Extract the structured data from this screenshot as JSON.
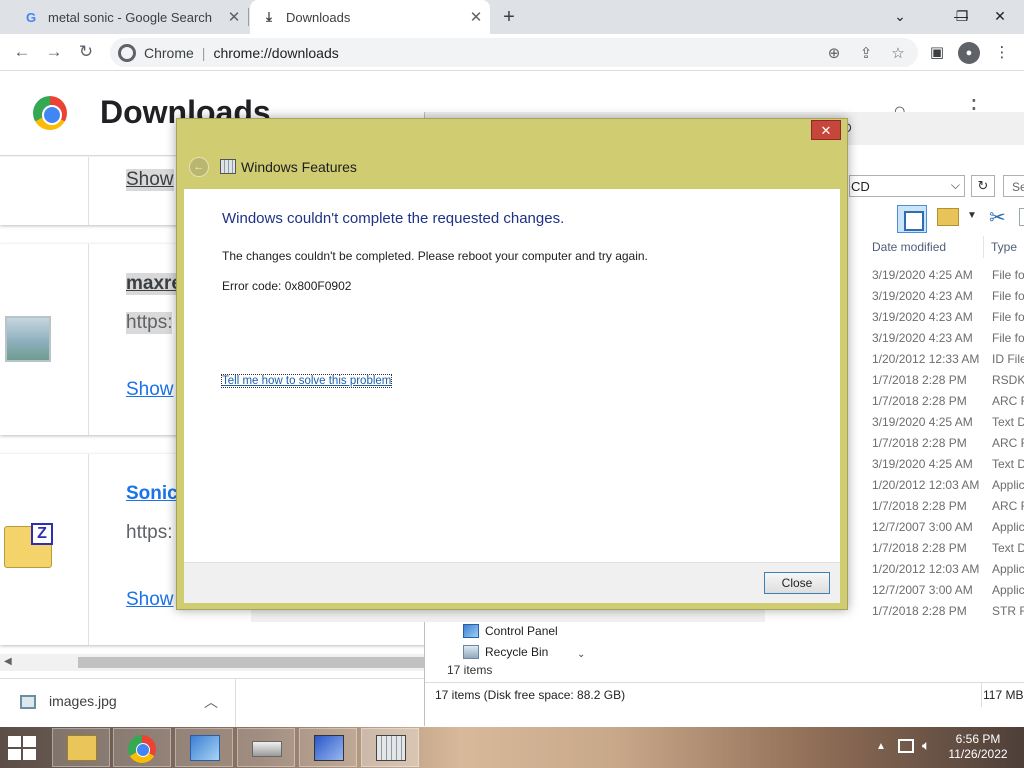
{
  "browser": {
    "tabs": [
      {
        "title": "metal sonic - Google Search",
        "icon": "google-icon"
      },
      {
        "title": "Downloads",
        "icon": "download-icon"
      }
    ],
    "omnibox": {
      "site_label": "Chrome",
      "separator": "|",
      "url": "chrome://downloads"
    }
  },
  "downloads_page": {
    "title": "Downloads",
    "items": [
      {
        "name_partial": "",
        "url_partial": "",
        "show_link": "Show"
      },
      {
        "name_partial": "maxre",
        "url_partial": "https:",
        "show_link": "Show"
      },
      {
        "name_partial": "Sonic",
        "url_partial": "https:",
        "show_link": "Show"
      }
    ],
    "download_bar": {
      "file_name": "images.jpg"
    }
  },
  "explorer": {
    "title_fragment": "D",
    "address": "CD",
    "search_placeholder": "Se",
    "columns": {
      "date": "Date modified",
      "type": "Type"
    },
    "rows": [
      {
        "date": "3/19/2020 4:25 AM",
        "type": "File fo"
      },
      {
        "date": "3/19/2020 4:23 AM",
        "type": "File fo"
      },
      {
        "date": "3/19/2020 4:23 AM",
        "type": "File fo"
      },
      {
        "date": "3/19/2020 4:23 AM",
        "type": "File fo"
      },
      {
        "date": "1/20/2012 12:33 AM",
        "type": "ID File"
      },
      {
        "date": "1/7/2018 2:28 PM",
        "type": "RSDK I"
      },
      {
        "date": "1/7/2018 2:28 PM",
        "type": "ARC F"
      },
      {
        "date": "3/19/2020 4:25 AM",
        "type": "Text D"
      },
      {
        "date": "1/7/2018 2:28 PM",
        "type": "ARC F"
      },
      {
        "date": "3/19/2020 4:25 AM",
        "type": "Text D"
      },
      {
        "date": "1/20/2012 12:03 AM",
        "type": "Applic"
      },
      {
        "date": "1/7/2018 2:28 PM",
        "type": "ARC F"
      },
      {
        "date": "12/7/2007 3:00 AM",
        "type": "Applic"
      },
      {
        "date": "1/7/2018 2:28 PM",
        "type": "Text D"
      },
      {
        "date": "1/20/2012 12:03 AM",
        "type": "Applic"
      },
      {
        "date": "12/7/2007 3:00 AM",
        "type": "Applic"
      },
      {
        "date": "1/7/2018 2:28 PM",
        "type": "STR Fi"
      }
    ],
    "nav": [
      {
        "label": "Control Panel",
        "icon": "control-panel-icon"
      },
      {
        "label": "Recycle Bin",
        "icon": "recycle-bin-icon"
      }
    ],
    "item_count": "17 items",
    "status_text": "17 items (Disk free space: 88.2 GB)",
    "status_size": "117 MB"
  },
  "dialog": {
    "title": "Windows Features",
    "headline": "Windows couldn't complete the requested changes.",
    "message": "The changes couldn't be completed. Please reboot your computer and try again.",
    "error_code": "Error code: 0x800F0902",
    "help_link": "Tell me how to solve this problem",
    "close_button": "Close",
    "close_glyph": "✕"
  },
  "taskbar": {
    "apps": [
      "file-explorer-icon",
      "chrome-icon",
      "control-panel-icon",
      "drive-icon",
      "setup-icon",
      "windows-features-icon"
    ],
    "time": "6:56 PM",
    "date": "11/26/2022"
  },
  "colors": {
    "dialog_frame": "#cfcc72",
    "dialog_headline": "#1e3287",
    "link": "#1a73e8",
    "taskbar": "#8c7464"
  }
}
